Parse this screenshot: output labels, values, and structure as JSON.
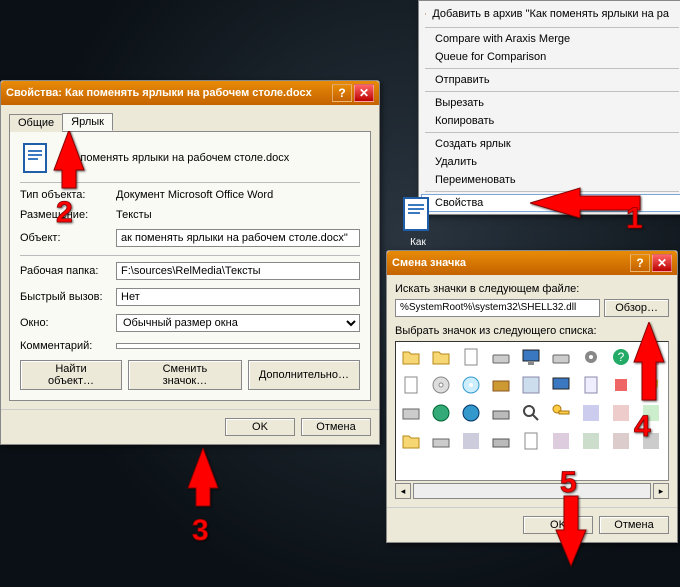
{
  "context_menu": {
    "items": [
      {
        "label": "Добавить в архив \"Как поменять ярлыки на ра",
        "icon": "archive-icon",
        "sep": false,
        "hl": false
      },
      {
        "sep": true
      },
      {
        "label": "Compare with Araxis Merge",
        "sep": false
      },
      {
        "label": "Queue for Comparison",
        "sep": false
      },
      {
        "sep": true
      },
      {
        "label": "Отправить",
        "sep": false
      },
      {
        "sep": true
      },
      {
        "label": "Вырезать",
        "sep": false
      },
      {
        "label": "Копировать",
        "sep": false
      },
      {
        "sep": true
      },
      {
        "label": "Создать ярлык",
        "sep": false
      },
      {
        "label": "Удалить",
        "sep": false
      },
      {
        "label": "Переименовать",
        "sep": false
      },
      {
        "sep": true
      },
      {
        "label": "Свойства",
        "hl": true,
        "sep": false
      }
    ]
  },
  "desktop_item": {
    "label": "Как поменять"
  },
  "props_dialog": {
    "title": "Свойства: Как поменять ярлыки на рабочем столе.docx",
    "tabs": {
      "general": "Общие",
      "shortcut": "Ярлык"
    },
    "shortcut": {
      "target_name": "Как поменять ярлыки на рабочем столе.docx",
      "type_label": "Тип объекта:",
      "type_value": "Документ Microsoft Office Word",
      "location_label": "Размещение:",
      "location_value": "Тексты",
      "object_label": "Объект:",
      "object_value": "ак поменять ярлыки на рабочем столе.docx\"",
      "workdir_label": "Рабочая папка:",
      "workdir_value": "F:\\sources\\RelMedia\\Тексты",
      "hotkey_label": "Быстрый вызов:",
      "hotkey_value": "Нет",
      "run_label": "Окно:",
      "run_value": "Обычный размер окна",
      "comment_label": "Комментарий:",
      "comment_value": "",
      "find_btn": "Найти объект…",
      "icon_btn": "Сменить значок…",
      "adv_btn": "Дополнительно…"
    },
    "ok": "OK",
    "cancel": "Отмена"
  },
  "icon_dialog": {
    "title": "Смена значка",
    "path_label": "Искать значки в следующем файле:",
    "path_value": "%SystemRoot%\\system32\\SHELL32.dll",
    "browse_btn": "Обзор…",
    "list_label": "Выбрать значок из следующего списка:",
    "ok": "OK",
    "cancel": "Отмена"
  },
  "arrows": {
    "1": "1",
    "2": "2",
    "3": "3",
    "4": "4",
    "5": "5"
  }
}
